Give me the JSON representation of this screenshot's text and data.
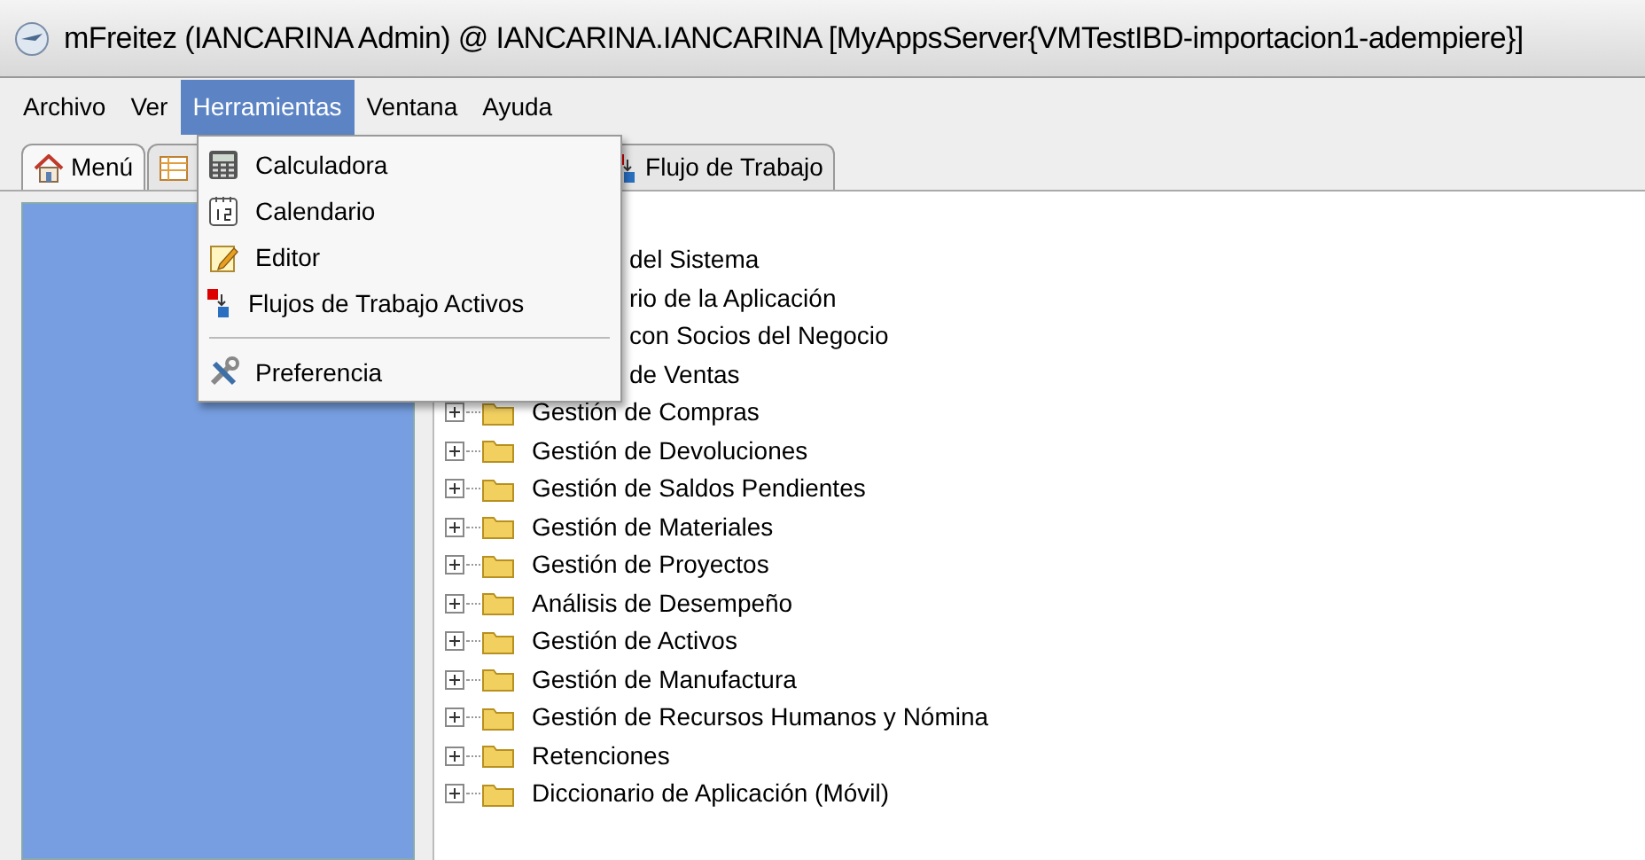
{
  "window": {
    "title": "mFreitez (IANCARINA Admin) @ IANCARINA.IANCARINA [MyAppsServer{VMTestIBD-importacion1-adempiere}]"
  },
  "menubar": [
    {
      "label": "Archivo",
      "selected": false
    },
    {
      "label": "Ver",
      "selected": false
    },
    {
      "label": "Herramientas",
      "selected": true
    },
    {
      "label": "Ventana",
      "selected": false
    },
    {
      "label": "Ayuda",
      "selected": false
    }
  ],
  "tabs": [
    {
      "label": "Menú",
      "kind": "home",
      "selected": true
    },
    {
      "kind": "list",
      "selected": false
    },
    {
      "label": "Flujo de Trabajo",
      "kind": "workflow",
      "selected": false
    }
  ],
  "dropdown": [
    {
      "kind": "calculator",
      "label": "Calculadora"
    },
    {
      "kind": "calendar",
      "label": "Calendario"
    },
    {
      "kind": "editor",
      "label": "Editor"
    },
    {
      "kind": "workflow",
      "label": "Flujos de Trabajo Activos"
    },
    {
      "kind": "separator"
    },
    {
      "kind": "tools",
      "label": "Preferencia"
    }
  ],
  "tree": [
    {
      "label": "del Sistema",
      "kind": "covered"
    },
    {
      "label": "rio de la Aplicación",
      "kind": "covered"
    },
    {
      "label": "con Socios del Negocio",
      "kind": "covered"
    },
    {
      "label": "de Ventas",
      "kind": "covered"
    },
    {
      "label": "Gestión de Compras",
      "kind": "folder"
    },
    {
      "label": "Gestión de Devoluciones",
      "kind": "folder"
    },
    {
      "label": "Gestión de Saldos Pendientes",
      "kind": "folder"
    },
    {
      "label": "Gestión de Materiales",
      "kind": "folder"
    },
    {
      "label": "Gestión de Proyectos",
      "kind": "folder"
    },
    {
      "label": "Análisis de Desempeño",
      "kind": "folder"
    },
    {
      "label": "Gestión de Activos",
      "kind": "folder"
    },
    {
      "label": "Gestión de Manufactura",
      "kind": "folder"
    },
    {
      "label": "Gestión de Recursos Humanos y Nómina",
      "kind": "folder"
    },
    {
      "label": "Retenciones",
      "kind": "folder"
    },
    {
      "label": "Diccionario de Aplicación (Móvil)",
      "kind": "folder"
    }
  ]
}
